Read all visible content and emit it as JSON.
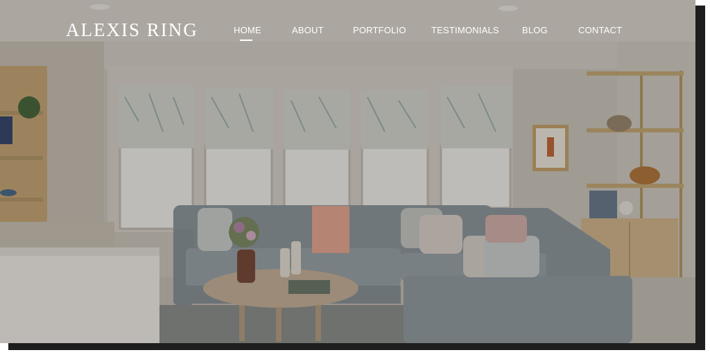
{
  "site": {
    "logo_text": "ALEXIS RING"
  },
  "nav": {
    "items": [
      {
        "label": "HOME",
        "active": true
      },
      {
        "label": "ABOUT",
        "active": false
      },
      {
        "label": "PORTFOLIO",
        "active": false
      },
      {
        "label": "TESTIMONIALS",
        "active": false
      },
      {
        "label": "BLOG",
        "active": false
      },
      {
        "label": "CONTACT",
        "active": false
      }
    ]
  },
  "colors": {
    "header_text": "#ffffff",
    "page_background": "#ffffff",
    "frame_shadow": "#1e1e1e"
  }
}
